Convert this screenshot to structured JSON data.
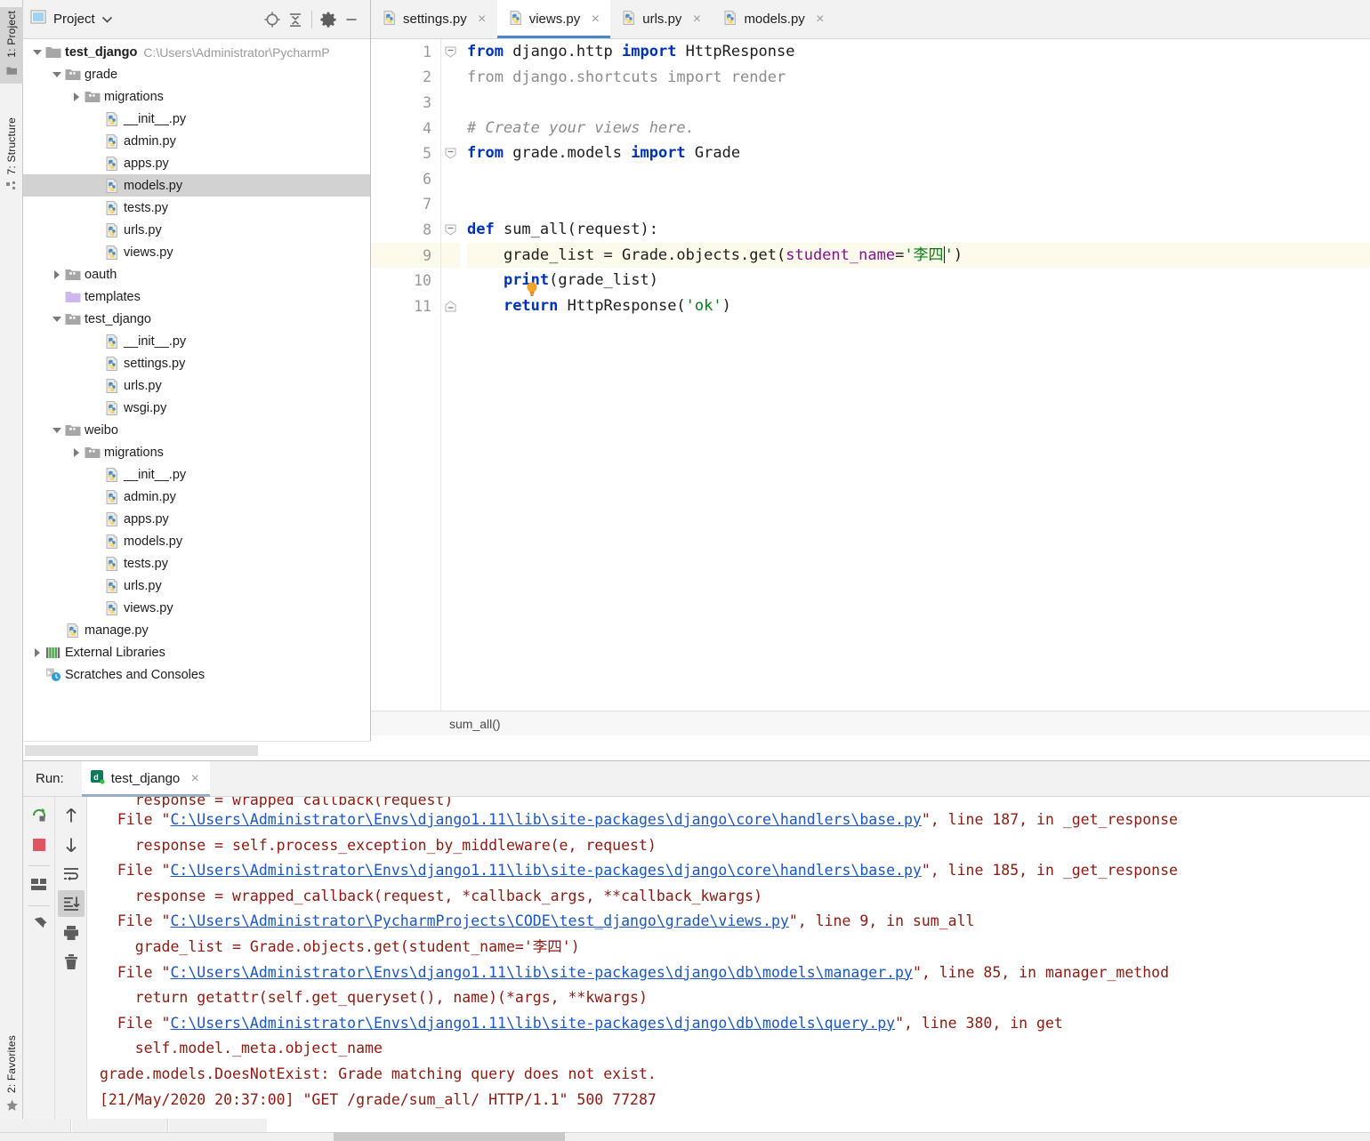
{
  "left_strip": {
    "tabs": [
      {
        "label": "1: Project",
        "icon": "folder-icon",
        "active": true
      },
      {
        "label": "7: Structure",
        "icon": "structure-icon",
        "active": false
      }
    ],
    "bottom_tabs": [
      {
        "label": "2: Favorites",
        "icon": "star-icon",
        "active": false
      }
    ]
  },
  "project_panel": {
    "title": "Project",
    "toolbar": [
      {
        "name": "locate-target-icon"
      },
      {
        "name": "collapse-all-icon"
      },
      {
        "name": "gear-icon"
      },
      {
        "name": "minimize-icon"
      }
    ],
    "tree": [
      {
        "indent": 0,
        "arrow": "down",
        "icon": "folder",
        "label": "test_django",
        "bold": true,
        "path": "C:\\Users\\Administrator\\PycharmP",
        "selected": false
      },
      {
        "indent": 1,
        "arrow": "down",
        "icon": "module",
        "label": "grade",
        "selected": false
      },
      {
        "indent": 2,
        "arrow": "right",
        "icon": "module",
        "label": "migrations",
        "selected": false
      },
      {
        "indent": 3,
        "arrow": "none",
        "icon": "python",
        "label": "__init__.py",
        "selected": false
      },
      {
        "indent": 3,
        "arrow": "none",
        "icon": "python",
        "label": "admin.py",
        "selected": false
      },
      {
        "indent": 3,
        "arrow": "none",
        "icon": "python",
        "label": "apps.py",
        "selected": false
      },
      {
        "indent": 3,
        "arrow": "none",
        "icon": "python",
        "label": "models.py",
        "selected": true
      },
      {
        "indent": 3,
        "arrow": "none",
        "icon": "python",
        "label": "tests.py",
        "selected": false
      },
      {
        "indent": 3,
        "arrow": "none",
        "icon": "python",
        "label": "urls.py",
        "selected": false
      },
      {
        "indent": 3,
        "arrow": "none",
        "icon": "python",
        "label": "views.py",
        "selected": false
      },
      {
        "indent": 1,
        "arrow": "right",
        "icon": "module",
        "label": "oauth",
        "selected": false
      },
      {
        "indent": 1,
        "arrow": "none",
        "icon": "tplfolder",
        "label": "templates",
        "selected": false
      },
      {
        "indent": 1,
        "arrow": "down",
        "icon": "module",
        "label": "test_django",
        "selected": false
      },
      {
        "indent": 3,
        "arrow": "none",
        "icon": "python",
        "label": "__init__.py",
        "selected": false
      },
      {
        "indent": 3,
        "arrow": "none",
        "icon": "python",
        "label": "settings.py",
        "selected": false
      },
      {
        "indent": 3,
        "arrow": "none",
        "icon": "python",
        "label": "urls.py",
        "selected": false
      },
      {
        "indent": 3,
        "arrow": "none",
        "icon": "python",
        "label": "wsgi.py",
        "selected": false
      },
      {
        "indent": 1,
        "arrow": "down",
        "icon": "module",
        "label": "weibo",
        "selected": false
      },
      {
        "indent": 2,
        "arrow": "right",
        "icon": "module",
        "label": "migrations",
        "selected": false
      },
      {
        "indent": 3,
        "arrow": "none",
        "icon": "python",
        "label": "__init__.py",
        "selected": false
      },
      {
        "indent": 3,
        "arrow": "none",
        "icon": "python",
        "label": "admin.py",
        "selected": false
      },
      {
        "indent": 3,
        "arrow": "none",
        "icon": "python",
        "label": "apps.py",
        "selected": false
      },
      {
        "indent": 3,
        "arrow": "none",
        "icon": "python",
        "label": "models.py",
        "selected": false
      },
      {
        "indent": 3,
        "arrow": "none",
        "icon": "python",
        "label": "tests.py",
        "selected": false
      },
      {
        "indent": 3,
        "arrow": "none",
        "icon": "python",
        "label": "urls.py",
        "selected": false
      },
      {
        "indent": 3,
        "arrow": "none",
        "icon": "python",
        "label": "views.py",
        "selected": false
      },
      {
        "indent": 1,
        "arrow": "none",
        "icon": "python",
        "label": "manage.py",
        "selected": false
      },
      {
        "indent": 0,
        "arrow": "right",
        "icon": "library",
        "label": "External Libraries",
        "selected": false
      },
      {
        "indent": 0,
        "arrow": "none",
        "icon": "scratch",
        "label": "Scratches and Consoles",
        "selected": false
      }
    ]
  },
  "editor": {
    "tabs": [
      {
        "label": "settings.py",
        "icon": "python-file-icon",
        "active": false,
        "close": "×"
      },
      {
        "label": "views.py",
        "icon": "python-file-icon",
        "active": true,
        "close": "×"
      },
      {
        "label": "urls.py",
        "icon": "python-file-icon",
        "active": false,
        "close": "×"
      },
      {
        "label": "models.py",
        "icon": "python-file-icon",
        "active": false,
        "close": "×"
      }
    ],
    "line_numbers": [
      "1",
      "2",
      "3",
      "4",
      "5",
      "6",
      "7",
      "8",
      "9",
      "10",
      "11"
    ],
    "highlight_line": 9,
    "lines": [
      {
        "n": 1,
        "tokens": [
          {
            "t": "from",
            "c": "kw"
          },
          {
            "t": " django.http ",
            "c": "plain"
          },
          {
            "t": "import",
            "c": "kw"
          },
          {
            "t": " HttpResponse",
            "c": "plain"
          }
        ]
      },
      {
        "n": 2,
        "tokens": [
          {
            "t": "from django.shortcuts import render",
            "c": "dim"
          }
        ]
      },
      {
        "n": 3,
        "tokens": []
      },
      {
        "n": 4,
        "tokens": [
          {
            "t": "# Create your views here.",
            "c": "cm"
          }
        ]
      },
      {
        "n": 5,
        "tokens": [
          {
            "t": "from",
            "c": "kw"
          },
          {
            "t": " grade.models ",
            "c": "plain"
          },
          {
            "t": "import",
            "c": "kw"
          },
          {
            "t": " Grade",
            "c": "plain"
          }
        ]
      },
      {
        "n": 6,
        "tokens": []
      },
      {
        "n": 7,
        "tokens": []
      },
      {
        "n": 8,
        "tokens": [
          {
            "t": "def",
            "c": "kw"
          },
          {
            "t": " sum_all(request):",
            "c": "plain"
          }
        ]
      },
      {
        "n": 9,
        "tokens": [
          {
            "t": "    grade_list = Grade.objects.get(",
            "c": "plain"
          },
          {
            "t": "student_name",
            "c": "param"
          },
          {
            "t": "=",
            "c": "plain"
          },
          {
            "t": "'李四'",
            "c": "str"
          },
          {
            "t": ")",
            "c": "plain"
          }
        ]
      },
      {
        "n": 10,
        "tokens": [
          {
            "t": "    ",
            "c": "plain"
          },
          {
            "t": "print",
            "c": "kw"
          },
          {
            "t": "(grade_list)",
            "c": "plain"
          }
        ]
      },
      {
        "n": 11,
        "tokens": [
          {
            "t": "    ",
            "c": "plain"
          },
          {
            "t": "return",
            "c": "kw"
          },
          {
            "t": " HttpResponse(",
            "c": "plain"
          },
          {
            "t": "'ok'",
            "c": "str"
          },
          {
            "t": ")",
            "c": "plain"
          }
        ]
      }
    ],
    "breadcrumb": "sum_all()"
  },
  "run_panel": {
    "label": "Run:",
    "tab": {
      "label": "test_django",
      "icon": "django-run-icon",
      "close": "×"
    },
    "toolbar_left": [
      {
        "name": "rerun-icon",
        "pressed": false
      },
      {
        "name": "stop-icon",
        "pressed": false
      },
      {
        "name": "layout-icon",
        "pressed": false
      },
      {
        "name": "pin-icon",
        "pressed": false
      }
    ],
    "toolbar_right": [
      {
        "name": "up-arrow-icon",
        "pressed": false
      },
      {
        "name": "down-arrow-icon",
        "pressed": false
      },
      {
        "name": "soft-wrap-icon",
        "pressed": false
      },
      {
        "name": "scroll-to-end-icon",
        "pressed": true
      },
      {
        "name": "print-icon",
        "pressed": false
      },
      {
        "name": "trash-icon",
        "pressed": false
      }
    ],
    "console": [
      {
        "kind": "clipped",
        "segments": [
          {
            "t": "    response = wrapped_callback(request)",
            "c": "err"
          }
        ]
      },
      {
        "kind": "file",
        "segments": [
          {
            "t": "  File \"",
            "c": "err"
          },
          {
            "t": "C:\\Users\\Administrator\\Envs\\django1.11\\lib\\site-packages\\django\\core\\handlers\\base.py",
            "c": "lnk"
          },
          {
            "t": "\", line 187, in _get_response",
            "c": "err"
          }
        ]
      },
      {
        "kind": "code",
        "segments": [
          {
            "t": "    response = self.process_exception_by_middleware(e, request)",
            "c": "err"
          }
        ]
      },
      {
        "kind": "file",
        "segments": [
          {
            "t": "  File \"",
            "c": "err"
          },
          {
            "t": "C:\\Users\\Administrator\\Envs\\django1.11\\lib\\site-packages\\django\\core\\handlers\\base.py",
            "c": "lnk"
          },
          {
            "t": "\", line 185, in _get_response",
            "c": "err"
          }
        ]
      },
      {
        "kind": "code",
        "segments": [
          {
            "t": "    response = wrapped_callback(request, *callback_args, **callback_kwargs)",
            "c": "err"
          }
        ]
      },
      {
        "kind": "file",
        "segments": [
          {
            "t": "  File \"",
            "c": "err"
          },
          {
            "t": "C:\\Users\\Administrator\\PycharmProjects\\CODE\\test_django\\grade\\views.py",
            "c": "lnk"
          },
          {
            "t": "\", line 9, in sum_all",
            "c": "err"
          }
        ]
      },
      {
        "kind": "code",
        "segments": [
          {
            "t": "    grade_list = Grade.objects.get(student_name='李四')",
            "c": "err"
          }
        ]
      },
      {
        "kind": "file",
        "segments": [
          {
            "t": "  File \"",
            "c": "err"
          },
          {
            "t": "C:\\Users\\Administrator\\Envs\\django1.11\\lib\\site-packages\\django\\db\\models\\manager.py",
            "c": "lnk"
          },
          {
            "t": "\", line 85, in manager_method",
            "c": "err"
          }
        ]
      },
      {
        "kind": "code",
        "segments": [
          {
            "t": "    return getattr(self.get_queryset(), name)(*args, **kwargs)",
            "c": "err"
          }
        ]
      },
      {
        "kind": "file",
        "segments": [
          {
            "t": "  File \"",
            "c": "err"
          },
          {
            "t": "C:\\Users\\Administrator\\Envs\\django1.11\\lib\\site-packages\\django\\db\\models\\query.py",
            "c": "lnk"
          },
          {
            "t": "\", line 380, in get",
            "c": "err"
          }
        ]
      },
      {
        "kind": "code",
        "segments": [
          {
            "t": "    self.model._meta.object_name",
            "c": "err"
          }
        ]
      },
      {
        "kind": "code",
        "segments": [
          {
            "t": "grade.models.DoesNotExist: Grade matching query does not exist.",
            "c": "err"
          }
        ]
      },
      {
        "kind": "code",
        "segments": [
          {
            "t": "[21/May/2020 20:37:00] \"GET /grade/sum_all/ HTTP/1.1\" 500 77287",
            "c": "err"
          }
        ]
      }
    ]
  },
  "colors": {
    "accent_tab": "#4a87c7",
    "keyword": "#0033b3",
    "string": "#067d17",
    "param": "#871094",
    "comment": "#8c8c8c",
    "console_error": "#8b1a10",
    "console_link": "#1a56c4",
    "selection": "#d2d2d2",
    "line_highlight": "#fcfbeb"
  }
}
